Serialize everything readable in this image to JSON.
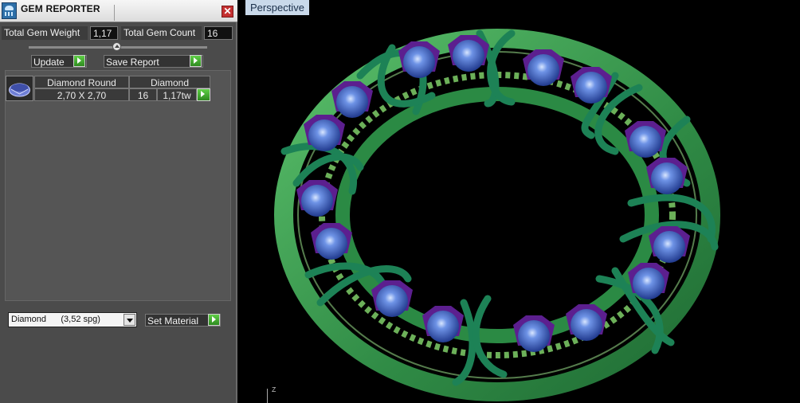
{
  "panel": {
    "title": "GEM REPORTER",
    "close_glyph": "✕",
    "stats": {
      "weight_label": "Total Gem Weight",
      "weight_value": "1,17",
      "count_label": "Total Gem Count",
      "count_value": "16"
    },
    "buttons": {
      "update": "Update",
      "save_report": "Save Report",
      "set_material": "Set Material"
    },
    "gem_row": {
      "shape": "Diamond Round",
      "material": "Diamond",
      "size": "2,70 X 2,70",
      "count": "16",
      "weight": "1,17tw"
    },
    "material_select": "Diamond      (3,52 spg)"
  },
  "viewport": {
    "tab": "Perspective",
    "axis": "Z"
  },
  "colors": {
    "ring": "#3f9a54",
    "wire": "#1d8256",
    "gem": "#3a62c8",
    "prong": "#5c1f8f",
    "gallery": "#7fcf69"
  },
  "icons": [
    "gem-reporter-app-icon",
    "close-icon",
    "play-arrow-icon",
    "chevron-down-icon",
    "slider-handle-icon"
  ]
}
